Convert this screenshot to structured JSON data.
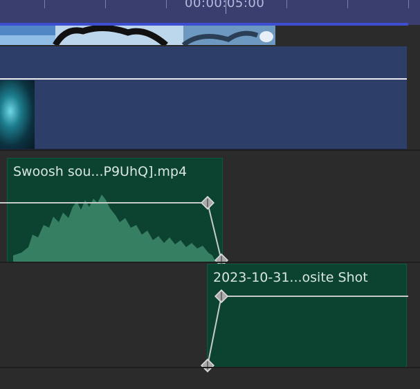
{
  "ruler": {
    "timecode": "00:00:05:00",
    "accent": "#3d4fd0",
    "background": "#393e6e"
  },
  "video_track": {
    "clip_color": "#2d3e68"
  },
  "audio_track_1": {
    "clip_title": "Swoosh sou...P9UhQ].mp4",
    "clip_color": "#0b4330"
  },
  "audio_track_2": {
    "clip_title": "2023-10-31...osite Shot",
    "clip_color": "#0b4330"
  },
  "icons": {
    "keyframe": "keyframe-diamond-icon"
  }
}
